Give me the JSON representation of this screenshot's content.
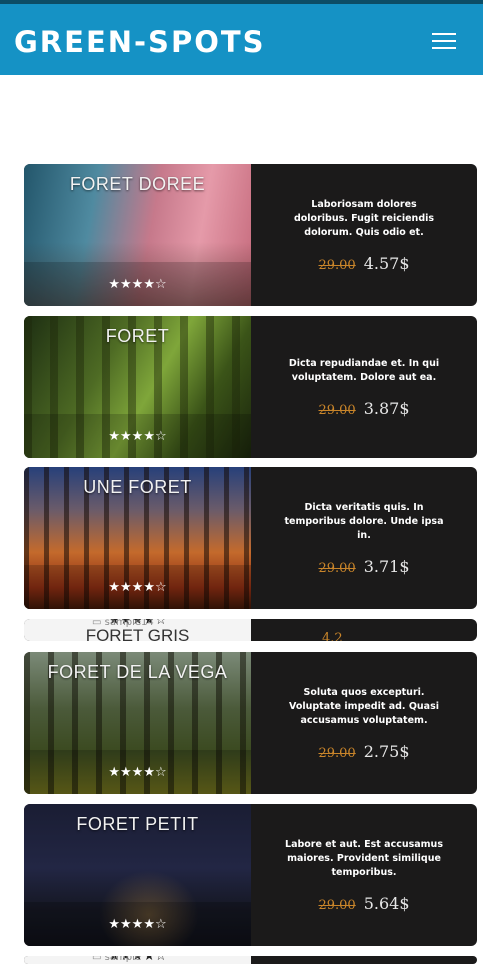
{
  "header": {
    "brand": "GREEN-SPOTS"
  },
  "cards": [
    {
      "title": "FORET DOREE",
      "rating": "★★★★☆",
      "description": "Laboriosam dolores doloribus. Fugit reiciendis dolorum. Quis odio et.",
      "old_price": "29.00",
      "price": "4.57$"
    },
    {
      "title": "FORET",
      "rating": "★★★★☆",
      "description": "Dicta repudiandae et. In qui voluptatem. Dolore aut ea.",
      "old_price": "29.00",
      "price": "3.87$"
    },
    {
      "title": "UNE FORET",
      "rating": "★★★★☆",
      "description": "Dicta veritatis quis. In temporibus dolore. Unde ipsa in.",
      "old_price": "29.00",
      "price": "3.71$"
    },
    {
      "title": "FORET GRIS",
      "rating": "★★★★☆",
      "image_alt": "sample14",
      "price": "4.2"
    },
    {
      "title": "FORET DE LA VEGA",
      "rating": "★★★★☆",
      "description": "Soluta quos excepturi. Voluptate impedit ad. Quasi accusamus voluptatem.",
      "old_price": "29.00",
      "price": "2.75$"
    },
    {
      "title": "FORET PETIT",
      "rating": "★★★★☆",
      "description": "Labore et aut. Est accusamus maiores. Provident similique temporibus.",
      "old_price": "29.00",
      "price": "5.64$"
    },
    {
      "rating": "★★★★☆",
      "image_alt": "sample"
    }
  ],
  "colors": {
    "navbar": "#1592c5",
    "card_bg": "#1b1a1a",
    "old_price": "#c9852a"
  }
}
